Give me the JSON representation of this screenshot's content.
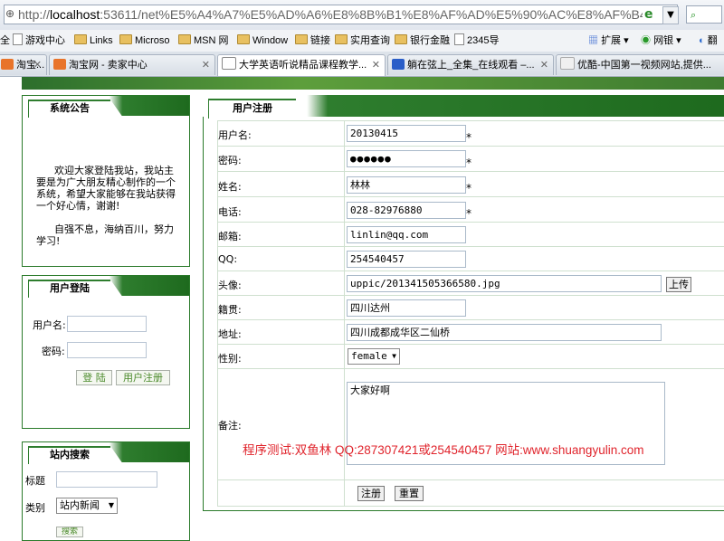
{
  "browser": {
    "url_prefix": "http://",
    "url_host": "localhost",
    "url_rest": ":53611/net%E5%A4%A7%E5%AD%A6%E8%8B%B1%E8%AF%AD%E5%90%AC%E8%AF%B4%E7%B2%BE%E5%93%81%E8%AF%BE%E7%A8%8B%E6%95%99%E5%AD%A6",
    "search_label": "",
    "bookmarks": [
      {
        "label": "全",
        "type": "text"
      },
      {
        "label": "游戏中心",
        "type": "doc"
      },
      {
        "label": "Links",
        "type": "folder"
      },
      {
        "label": "Microso",
        "type": "folder"
      },
      {
        "label": "MSN 网",
        "type": "folder"
      },
      {
        "label": "Window",
        "type": "folder"
      },
      {
        "label": "链接",
        "type": "folder"
      },
      {
        "label": "实用查询",
        "type": "folder"
      },
      {
        "label": "银行金融",
        "type": "folder"
      },
      {
        "label": "2345导",
        "type": "doc"
      }
    ],
    "right_tools": {
      "extend": "扩展",
      "bank": "网银",
      "translate": "翻"
    },
    "tabs": [
      {
        "label": "淘宝...",
        "color": "#e8742a"
      },
      {
        "label": "淘宝网 - 卖家中心",
        "color": "#e8742a"
      },
      {
        "label": "大学英语听说精品课程教学...",
        "color": "#ffffff",
        "active": true
      },
      {
        "label": "躺在弦上_全集_在线观看 –...",
        "color": "#2a5ec8"
      },
      {
        "label": "优酷-中国第一视频网站,提供...",
        "color": "#f0f0f0"
      }
    ]
  },
  "sidebar": {
    "notice": {
      "title": "系统公告",
      "paragraph1": "欢迎大家登陆我站，我站主要是为广大朋友精心制作的一个系统，希望大家能够在我站获得一个好心情，谢谢!",
      "paragraph2": "自强不息，海纳百川，努力学习!"
    },
    "login": {
      "title": "用户登陆",
      "username_label": "用户名:",
      "password_label": "密码:",
      "login_button": "登 陆",
      "register_button": "用户注册"
    },
    "search": {
      "title": "站内搜索",
      "title_label": "标题",
      "category_label": "类别",
      "category_value": "站内新闻",
      "search_button": "搜索"
    }
  },
  "register": {
    "title": "用户注册",
    "fields": [
      {
        "label": "用户名:",
        "value": "20130415",
        "required": true
      },
      {
        "label": "密码:",
        "value": "●●●●●●",
        "required": true
      },
      {
        "label": "姓名:",
        "value": "林林",
        "required": true
      },
      {
        "label": "电话:",
        "value": "028-82976880",
        "required": true
      },
      {
        "label": "邮箱:",
        "value": "linlin@qq.com",
        "required": false
      },
      {
        "label": "QQ:",
        "value": "254540457",
        "required": false
      },
      {
        "label": "头像:",
        "value": "uppic/201341505366580.jpg",
        "required": false
      },
      {
        "label": "籍贯:",
        "value": "四川达州",
        "required": false
      },
      {
        "label": "地址:",
        "value": "四川成都成华区二仙桥",
        "required": false
      },
      {
        "label": "性别:",
        "value": "female",
        "required": false
      },
      {
        "label": "备注:",
        "value": "大家好啊",
        "required": false
      }
    ],
    "required_mark": "*",
    "upload_button": "上传",
    "submit_button": "注册",
    "reset_button": "重置"
  },
  "watermark": "程序测试:双鱼林 QQ:287307421或254540457 网站:www.shuangyulin.com"
}
